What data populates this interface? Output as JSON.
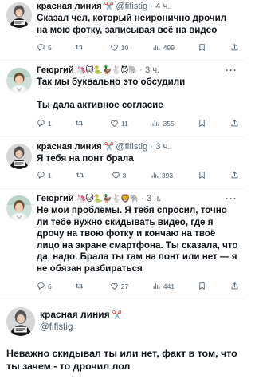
{
  "tweets": [
    {
      "name": "красная линия",
      "emoji": "✂️",
      "handle": "@fifistig",
      "dot": "·",
      "time": "4 ч.",
      "text": "Сказал чел, который неиронично дрочил на мою фотку, записывая всё на видео",
      "replies": "5",
      "retweets": "",
      "likes": "10",
      "views": "499"
    },
    {
      "name": "Геюргий",
      "emoji": "🦄🐱🐍🦆🐇😈🐘",
      "dot": "·",
      "time": "3 ч.",
      "text": "Так мы буквально это обсудили\n\nТы дала активное согласие",
      "replies": "1",
      "retweets": "",
      "likes": "11",
      "views": "355"
    },
    {
      "name": "красная линия",
      "emoji": "✂️",
      "handle": "@fifistig",
      "dot": "·",
      "time": "3 ч.",
      "text": "Я тебя на понт брала",
      "replies": "1",
      "retweets": "",
      "likes": "3",
      "views": "393"
    },
    {
      "name": "Геюргий",
      "emoji": "🦄🐱🐍🦆🐇🦁🐘",
      "dot": "·",
      "time": "3 ч.",
      "text": "Не мои проблемы. Я тебя спросил, точно ли тебе нужно скидывать видео, где я дрочу на твою фотку и кончаю на твоё лицо на экране смартфона. Ты сказала, что да, надо. Брала ты там на понт или нет — я не обязан разбираться",
      "replies": "6",
      "retweets": "",
      "likes": "27",
      "views": "441"
    }
  ],
  "main": {
    "name": "красная линия",
    "emoji": "✂️",
    "handle": "@fifistig",
    "text": "Неважно скидывал ты или нет, факт в том, что ты зачем - то дрочил лол"
  },
  "more_label": "···",
  "colors": {
    "text": "#0f1419",
    "muted": "#536471",
    "line": "#cfd9de"
  }
}
